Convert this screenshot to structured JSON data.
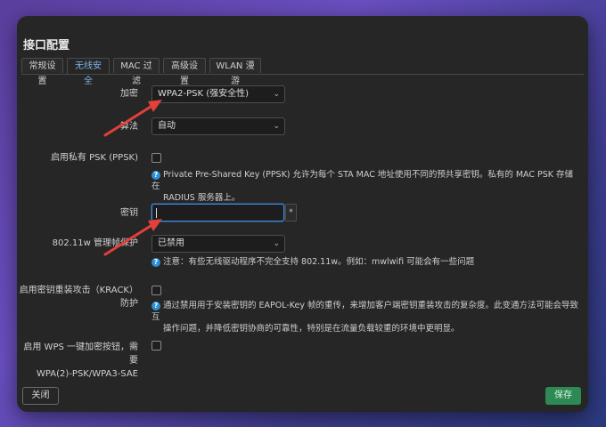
{
  "dialog": {
    "title": "接口配置",
    "tabs": [
      {
        "label": "常规设置",
        "active": false
      },
      {
        "label": "无线安全",
        "active": true
      },
      {
        "label": "MAC 过滤",
        "active": false
      },
      {
        "label": "高级设置",
        "active": false
      },
      {
        "label": "WLAN 漫游",
        "active": false
      }
    ]
  },
  "form": {
    "encryption": {
      "label": "加密",
      "value": "WPA2-PSK (强安全性)"
    },
    "cipher": {
      "label": "算法",
      "value": "自动"
    },
    "ppsk": {
      "label": "启用私有 PSK (PPSK)",
      "help_line1": "Private Pre-Shared Key (PPSK) 允许为每个 STA MAC 地址使用不同的预共享密钥。私有的 MAC PSK 存储在",
      "help_line2": "RADIUS 服务器上。"
    },
    "key": {
      "label": "密钥",
      "value": "",
      "reveal": "*"
    },
    "mfp": {
      "label": "802.11w 管理帧保护",
      "value": "已禁用",
      "help": "注意：有些无线驱动程序不完全支持 802.11w。例如：mwlwifi 可能会有一些问题"
    },
    "krack": {
      "label_line1": "启用密钥重装攻击（KRACK）",
      "label_line2": "防护",
      "help_line1": "通过禁用用于安装密钥的 EAPOL-Key 帧的重传，来增加客户端密钥重装攻击的复杂度。此变通方法可能会导致互",
      "help_line2": "操作问题，并降低密钥协商的可靠性，特别是在流量负载较重的环境中更明显。"
    },
    "wps": {
      "label_line1": "启用 WPS 一键加密按钮，需要",
      "label_line2": "WPA(2)-PSK/WPA3-SAE"
    }
  },
  "footer": {
    "close": "关闭",
    "save": "保存"
  },
  "colors": {
    "accent": "#3f8fe0",
    "save": "#2e8a55",
    "arrow": "#e2403a"
  }
}
